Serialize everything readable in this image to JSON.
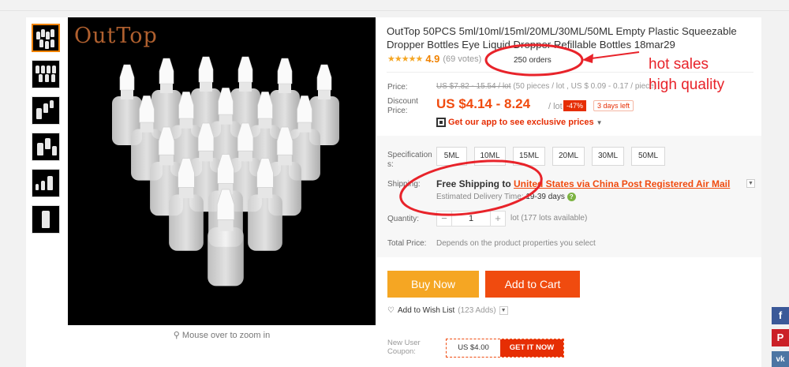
{
  "product": {
    "title": "OutTop 50PCS 5ml/10ml/15ml/20ML/30ML/50ML Empty Plastic Squeezable Dropper Bottles Eye Liquid Dropper Refillable Bottles 18mar29",
    "brand_watermark": "OutTop",
    "rating_score": "4.9",
    "rating_votes": "(69 votes)",
    "rating_value": 4.9,
    "orders": "250 orders",
    "zoom_hint": "Mouse over to zoom in"
  },
  "pricing": {
    "price_label": "Price:",
    "old_price": "US $7.82 - 15.54 / lot",
    "old_price_note": "(50 pieces / lot , US $ 0.09 - 0.17 / piece)",
    "discount_label_1": "Discount",
    "discount_label_2": "Price:",
    "discount_price": "US $4.14 - 8.24",
    "discount_unit": "/ lot",
    "discount_pct": "-47%",
    "days_left": "3 days left",
    "app_promo": "Get our app to see exclusive prices"
  },
  "spec": {
    "label_1": "Specification",
    "label_2": "s:",
    "options": [
      "5ML",
      "10ML",
      "15ML",
      "20ML",
      "30ML",
      "50ML"
    ]
  },
  "shipping": {
    "label": "Shipping:",
    "free_text": "Free Shipping to",
    "method": "United States via China Post Registered Air Mail",
    "eta_label": "Estimated Delivery Time:",
    "eta_value": "19-39 days"
  },
  "quantity": {
    "label": "Quantity:",
    "value": "1",
    "lots_available": "lot (177 lots available)"
  },
  "total": {
    "label": "Total Price:",
    "value": "Depends on the product properties you select"
  },
  "actions": {
    "buy_now": "Buy Now",
    "add_to_cart": "Add to Cart",
    "wish_label": "Add to Wish List",
    "wish_count": "(123 Adds)"
  },
  "coupon": {
    "label_1": "New User",
    "label_2": "Coupon:",
    "amount": "US $4.00",
    "cta": "GET IT NOW"
  },
  "annotations": {
    "hot_sales": "hot sales",
    "high_quality": "high quality"
  },
  "social": [
    "f",
    "P",
    "vk"
  ],
  "colors": {
    "accent_orange": "#f5a623",
    "accent_red": "#f04b0f",
    "annotation_red": "#e8232a"
  },
  "icons": [
    "heart-icon",
    "magnifier-icon",
    "qr-code-icon",
    "help-icon",
    "facebook-icon",
    "pinterest-icon",
    "vk-icon"
  ]
}
